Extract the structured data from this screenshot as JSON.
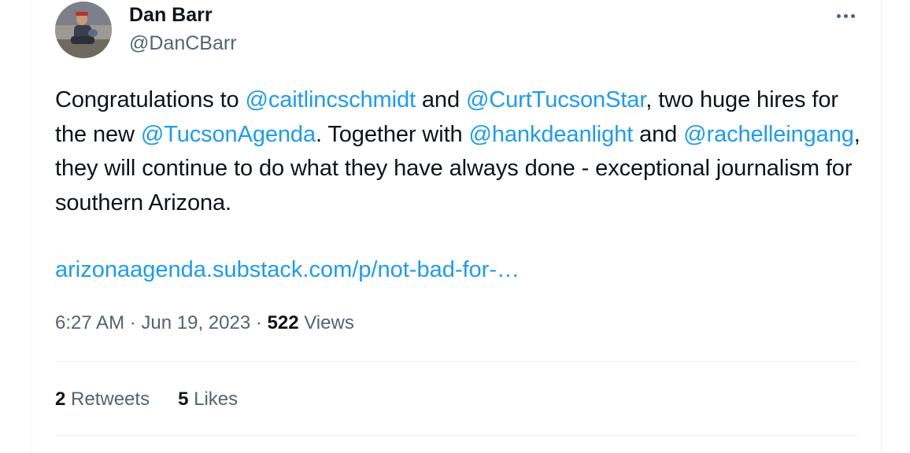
{
  "author": {
    "display_name": "Dan Barr",
    "handle": "@DanCBarr"
  },
  "tweet": {
    "parts": {
      "p1": "Congratulations to ",
      "m1": "@caitlincschmidt",
      "p2": " and ",
      "m2": "@CurtTucsonStar",
      "p3": ", two huge hires for the new ",
      "m3": "@TucsonAgenda",
      "p4": ". Together with ",
      "m4": "@hankdeanlight",
      "p5": " and ",
      "m5": "@rachelleingang",
      "p6": ", they will continue to do what they have always done - exceptional journalism for southern Arizona."
    },
    "link": "arizonaagenda.substack.com/p/not-bad-for-…"
  },
  "meta": {
    "time": "6:27 AM",
    "separator": " · ",
    "date": "Jun 19, 2023",
    "views_count": "522",
    "views_label": " Views"
  },
  "stats": {
    "retweets_count": "2",
    "retweets_label": " Retweets",
    "likes_count": "5",
    "likes_label": " Likes"
  },
  "colors": {
    "link": "#1d9bf0",
    "secondary_text": "#536471",
    "primary_text": "#0f1419",
    "divider": "#eff3f4"
  },
  "icons": {
    "more": "more-horizontal-icon"
  }
}
